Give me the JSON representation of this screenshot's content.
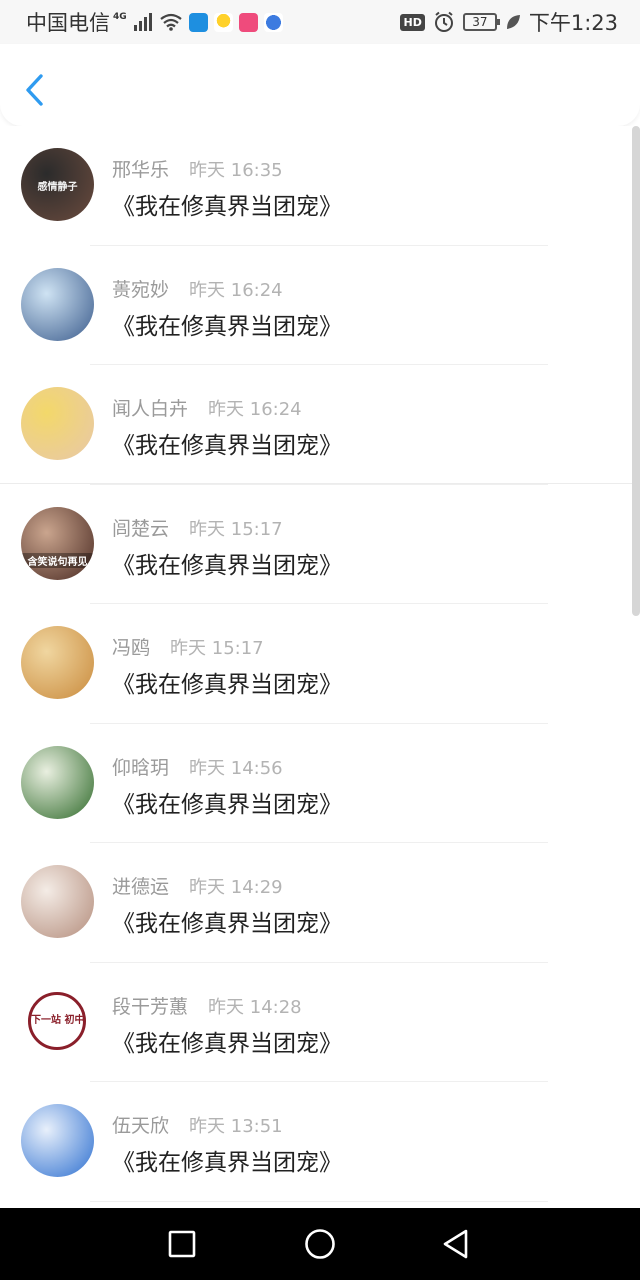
{
  "status_bar": {
    "carrier": "中国电信",
    "network": "4G",
    "hd": "HD",
    "battery": "37",
    "time": "下午1:23",
    "icons": [
      "signal-icon",
      "wifi-icon",
      "weather-app-icon",
      "bird-app-icon",
      "pink-app-icon",
      "blue-app-icon",
      "alarm-icon",
      "leaf-icon"
    ]
  },
  "header": {
    "back_icon": "chevron-left-icon",
    "accent_color": "#2f9bf0"
  },
  "messages": [
    {
      "name": "邢华乐",
      "time": "昨天 16:35",
      "text": "《我在修真界当团宠》",
      "avatar_text": "感情静子",
      "avatar_colors": [
        "#2b2b2b",
        "#6b4b3e"
      ]
    },
    {
      "name": "蒉宛妙",
      "time": "昨天 16:24",
      "text": "《我在修真界当团宠》",
      "avatar_text": "",
      "avatar_colors": [
        "#cfe3f3",
        "#3a5b8c"
      ]
    },
    {
      "name": "闻人白卉",
      "time": "昨天 16:24",
      "text": "《我在修真界当团宠》",
      "avatar_text": "",
      "avatar_colors": [
        "#f3d86a",
        "#e8c8a8"
      ]
    },
    {
      "name": "闾楚云",
      "time": "昨天 15:17",
      "text": "《我在修真界当团宠》",
      "avatar_text": "含笑说句再见",
      "avatar_colors": [
        "#caa58e",
        "#4a2a22"
      ]
    },
    {
      "name": "冯鸥",
      "time": "昨天 15:17",
      "text": "《我在修真界当团宠》",
      "avatar_text": "",
      "avatar_colors": [
        "#f0d6a0",
        "#c98a3c"
      ]
    },
    {
      "name": "仰晗玥",
      "time": "昨天 14:56",
      "text": "《我在修真界当团宠》",
      "avatar_text": "",
      "avatar_colors": [
        "#e9efe0",
        "#2f6a2a"
      ]
    },
    {
      "name": "进德运",
      "time": "昨天 14:29",
      "text": "《我在修真界当团宠》",
      "avatar_text": "",
      "avatar_colors": [
        "#f4ece6",
        "#b48d7c"
      ]
    },
    {
      "name": "段干芳蕙",
      "time": "昨天 14:28",
      "text": "《我在修真界当团宠》",
      "avatar_text": "下一站 初中",
      "avatar_colors": [
        "#ffffff",
        "#8a1f2a"
      ]
    },
    {
      "name": "伍天欣",
      "time": "昨天 13:51",
      "text": "《我在修真界当团宠》",
      "avatar_text": "",
      "avatar_colors": [
        "#e8f0fb",
        "#2d6fd0"
      ]
    }
  ],
  "nav_bar": {
    "buttons": [
      "recent-apps-icon",
      "home-icon",
      "back-triangle-icon"
    ]
  }
}
